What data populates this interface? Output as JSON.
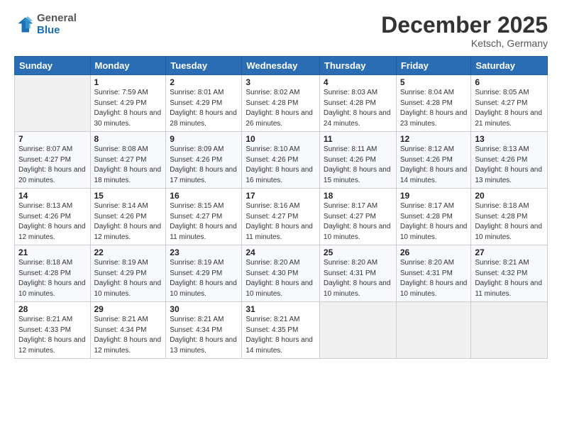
{
  "logo": {
    "line1": "General",
    "line2": "Blue"
  },
  "header": {
    "month": "December 2025",
    "location": "Ketsch, Germany"
  },
  "weekdays": [
    "Sunday",
    "Monday",
    "Tuesday",
    "Wednesday",
    "Thursday",
    "Friday",
    "Saturday"
  ],
  "weeks": [
    [
      {
        "day": "",
        "sunrise": "",
        "sunset": "",
        "daylight": ""
      },
      {
        "day": "1",
        "sunrise": "Sunrise: 7:59 AM",
        "sunset": "Sunset: 4:29 PM",
        "daylight": "Daylight: 8 hours and 30 minutes."
      },
      {
        "day": "2",
        "sunrise": "Sunrise: 8:01 AM",
        "sunset": "Sunset: 4:29 PM",
        "daylight": "Daylight: 8 hours and 28 minutes."
      },
      {
        "day": "3",
        "sunrise": "Sunrise: 8:02 AM",
        "sunset": "Sunset: 4:28 PM",
        "daylight": "Daylight: 8 hours and 26 minutes."
      },
      {
        "day": "4",
        "sunrise": "Sunrise: 8:03 AM",
        "sunset": "Sunset: 4:28 PM",
        "daylight": "Daylight: 8 hours and 24 minutes."
      },
      {
        "day": "5",
        "sunrise": "Sunrise: 8:04 AM",
        "sunset": "Sunset: 4:28 PM",
        "daylight": "Daylight: 8 hours and 23 minutes."
      },
      {
        "day": "6",
        "sunrise": "Sunrise: 8:05 AM",
        "sunset": "Sunset: 4:27 PM",
        "daylight": "Daylight: 8 hours and 21 minutes."
      }
    ],
    [
      {
        "day": "7",
        "sunrise": "Sunrise: 8:07 AM",
        "sunset": "Sunset: 4:27 PM",
        "daylight": "Daylight: 8 hours and 20 minutes."
      },
      {
        "day": "8",
        "sunrise": "Sunrise: 8:08 AM",
        "sunset": "Sunset: 4:27 PM",
        "daylight": "Daylight: 8 hours and 18 minutes."
      },
      {
        "day": "9",
        "sunrise": "Sunrise: 8:09 AM",
        "sunset": "Sunset: 4:26 PM",
        "daylight": "Daylight: 8 hours and 17 minutes."
      },
      {
        "day": "10",
        "sunrise": "Sunrise: 8:10 AM",
        "sunset": "Sunset: 4:26 PM",
        "daylight": "Daylight: 8 hours and 16 minutes."
      },
      {
        "day": "11",
        "sunrise": "Sunrise: 8:11 AM",
        "sunset": "Sunset: 4:26 PM",
        "daylight": "Daylight: 8 hours and 15 minutes."
      },
      {
        "day": "12",
        "sunrise": "Sunrise: 8:12 AM",
        "sunset": "Sunset: 4:26 PM",
        "daylight": "Daylight: 8 hours and 14 minutes."
      },
      {
        "day": "13",
        "sunrise": "Sunrise: 8:13 AM",
        "sunset": "Sunset: 4:26 PM",
        "daylight": "Daylight: 8 hours and 13 minutes."
      }
    ],
    [
      {
        "day": "14",
        "sunrise": "Sunrise: 8:13 AM",
        "sunset": "Sunset: 4:26 PM",
        "daylight": "Daylight: 8 hours and 12 minutes."
      },
      {
        "day": "15",
        "sunrise": "Sunrise: 8:14 AM",
        "sunset": "Sunset: 4:26 PM",
        "daylight": "Daylight: 8 hours and 12 minutes."
      },
      {
        "day": "16",
        "sunrise": "Sunrise: 8:15 AM",
        "sunset": "Sunset: 4:27 PM",
        "daylight": "Daylight: 8 hours and 11 minutes."
      },
      {
        "day": "17",
        "sunrise": "Sunrise: 8:16 AM",
        "sunset": "Sunset: 4:27 PM",
        "daylight": "Daylight: 8 hours and 11 minutes."
      },
      {
        "day": "18",
        "sunrise": "Sunrise: 8:17 AM",
        "sunset": "Sunset: 4:27 PM",
        "daylight": "Daylight: 8 hours and 10 minutes."
      },
      {
        "day": "19",
        "sunrise": "Sunrise: 8:17 AM",
        "sunset": "Sunset: 4:28 PM",
        "daylight": "Daylight: 8 hours and 10 minutes."
      },
      {
        "day": "20",
        "sunrise": "Sunrise: 8:18 AM",
        "sunset": "Sunset: 4:28 PM",
        "daylight": "Daylight: 8 hours and 10 minutes."
      }
    ],
    [
      {
        "day": "21",
        "sunrise": "Sunrise: 8:18 AM",
        "sunset": "Sunset: 4:28 PM",
        "daylight": "Daylight: 8 hours and 10 minutes."
      },
      {
        "day": "22",
        "sunrise": "Sunrise: 8:19 AM",
        "sunset": "Sunset: 4:29 PM",
        "daylight": "Daylight: 8 hours and 10 minutes."
      },
      {
        "day": "23",
        "sunrise": "Sunrise: 8:19 AM",
        "sunset": "Sunset: 4:29 PM",
        "daylight": "Daylight: 8 hours and 10 minutes."
      },
      {
        "day": "24",
        "sunrise": "Sunrise: 8:20 AM",
        "sunset": "Sunset: 4:30 PM",
        "daylight": "Daylight: 8 hours and 10 minutes."
      },
      {
        "day": "25",
        "sunrise": "Sunrise: 8:20 AM",
        "sunset": "Sunset: 4:31 PM",
        "daylight": "Daylight: 8 hours and 10 minutes."
      },
      {
        "day": "26",
        "sunrise": "Sunrise: 8:20 AM",
        "sunset": "Sunset: 4:31 PM",
        "daylight": "Daylight: 8 hours and 10 minutes."
      },
      {
        "day": "27",
        "sunrise": "Sunrise: 8:21 AM",
        "sunset": "Sunset: 4:32 PM",
        "daylight": "Daylight: 8 hours and 11 minutes."
      }
    ],
    [
      {
        "day": "28",
        "sunrise": "Sunrise: 8:21 AM",
        "sunset": "Sunset: 4:33 PM",
        "daylight": "Daylight: 8 hours and 12 minutes."
      },
      {
        "day": "29",
        "sunrise": "Sunrise: 8:21 AM",
        "sunset": "Sunset: 4:34 PM",
        "daylight": "Daylight: 8 hours and 12 minutes."
      },
      {
        "day": "30",
        "sunrise": "Sunrise: 8:21 AM",
        "sunset": "Sunset: 4:34 PM",
        "daylight": "Daylight: 8 hours and 13 minutes."
      },
      {
        "day": "31",
        "sunrise": "Sunrise: 8:21 AM",
        "sunset": "Sunset: 4:35 PM",
        "daylight": "Daylight: 8 hours and 14 minutes."
      },
      {
        "day": "",
        "sunrise": "",
        "sunset": "",
        "daylight": ""
      },
      {
        "day": "",
        "sunrise": "",
        "sunset": "",
        "daylight": ""
      },
      {
        "day": "",
        "sunrise": "",
        "sunset": "",
        "daylight": ""
      }
    ]
  ]
}
